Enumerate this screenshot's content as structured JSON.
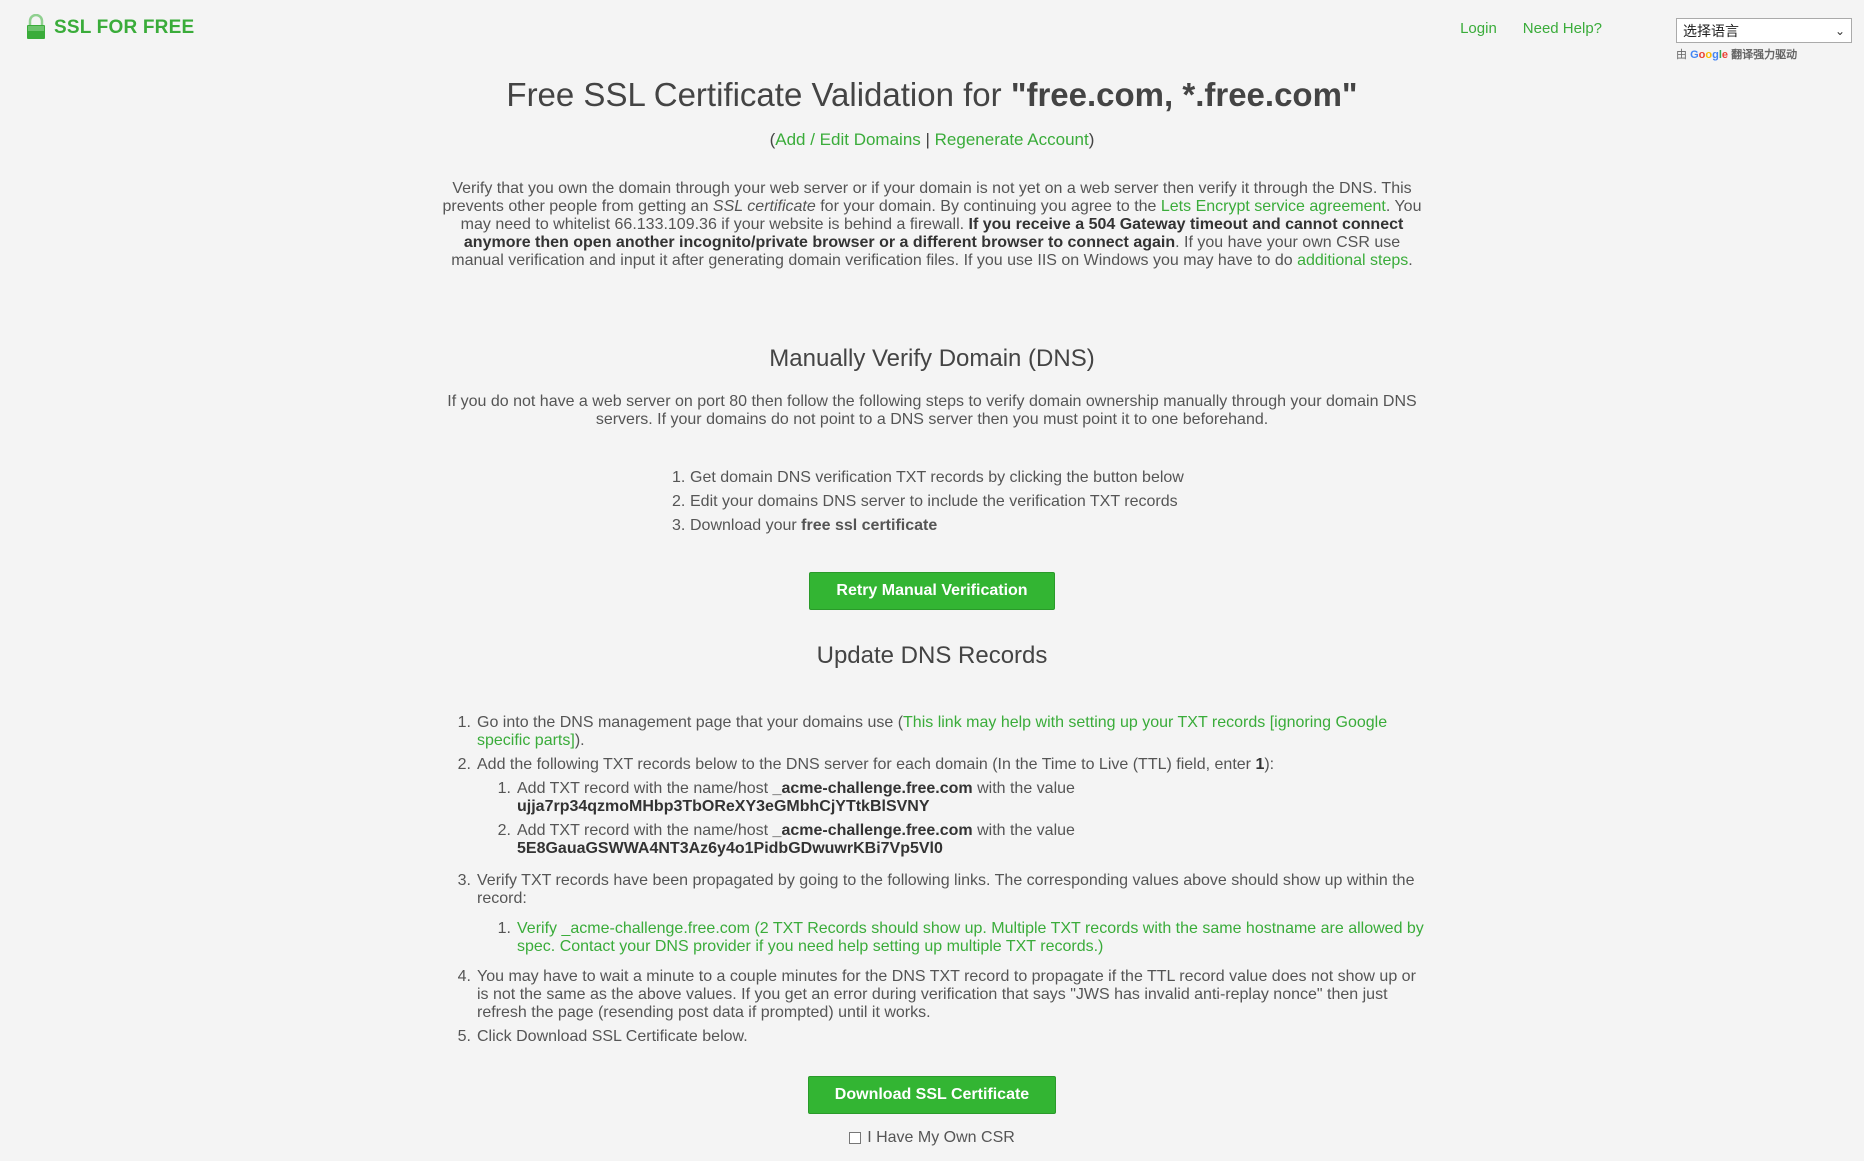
{
  "header": {
    "logo_text": "SSL FOR FREE",
    "nav": {
      "login": "Login",
      "help": "Need Help?"
    },
    "language": {
      "selected": "选择语言",
      "powered_prefix": "由",
      "google": "Google",
      "powered_suffix": "翻译强力驱动"
    }
  },
  "title": {
    "prefix": "Free SSL Certificate Validation for ",
    "domains": "\"free.com, *.free.com\""
  },
  "sublinks": {
    "open": "(",
    "add_edit": "Add / Edit Domains",
    "sep": " | ",
    "regenerate": "Regenerate Account",
    "close": ")"
  },
  "intro": {
    "t1": "Verify that you own the domain through your web server or if your domain is not yet on a web server then verify it through the DNS. This prevents other people from getting an ",
    "em": "SSL certificate",
    "t2": " for your domain. By continuing you agree to the ",
    "link1": "Lets Encrypt service agreement",
    "t3": ". You may need to whitelist 66.133.109.36 if your website is behind a firewall. ",
    "bold": "If you receive a 504 Gateway timeout and cannot connect anymore then open another incognito/private browser or a different browser to connect again",
    "t4": ". If you have your own CSR use manual verification and input it after generating domain verification files. If you use IIS on Windows you may have to do ",
    "link2": "additional steps",
    "t5": "."
  },
  "manual": {
    "heading": "Manually Verify Domain (DNS)",
    "desc": "If you do not have a web server on port 80 then follow the following steps to verify domain ownership manually through your domain DNS servers. If your domains do not point to a DNS server then you must point it to one beforehand.",
    "steps": [
      {
        "num": "1.",
        "text": "Get domain DNS verification TXT records by clicking the button below"
      },
      {
        "num": "2.",
        "text": "Edit your domains DNS server to include the verification TXT records"
      },
      {
        "num": "3.",
        "text": "Download your ",
        "bold": "free ssl certificate"
      }
    ],
    "retry_button": "Retry Manual Verification"
  },
  "update": {
    "heading": "Update DNS Records",
    "item1": {
      "num": "1.",
      "pre": "Go into the DNS management page that your domains use (",
      "link": "This link may help with setting up your TXT records [ignoring Google specific parts]",
      "post": ")."
    },
    "item2": {
      "num": "2.",
      "pre": "Add the following TXT records below to the DNS server for each domain (In the Time to Live (TTL) field, enter ",
      "ttl": "1",
      "post": "):"
    },
    "records": [
      {
        "num": "1.",
        "pre": "Add TXT record with the name/host ",
        "host": "_acme-challenge.free.com",
        "mid": " with the value",
        "value": "ujja7rp34qzmoMHbp3TbOReXY3eGMbhCjYTtkBlSVNY"
      },
      {
        "num": "2.",
        "pre": "Add TXT record with the name/host ",
        "host": "_acme-challenge.free.com",
        "mid": " with the value",
        "value": "5E8GauaGSWWA4NT3Az6y4o1PidbGDwuwrKBi7Vp5Vl0"
      }
    ],
    "item3": {
      "num": "3.",
      "text": "Verify TXT records have been propagated by going to the following links. The corresponding values above should show up within the record:"
    },
    "verify_link": {
      "num": "1.",
      "text": "Verify _acme-challenge.free.com (2 TXT Records should show up. Multiple TXT records with the same hostname are allowed by spec. Contact your DNS provider if you need help setting up multiple TXT records.)"
    },
    "item4": {
      "num": "4.",
      "text": "You may have to wait a minute to a couple minutes for the DNS TXT record to propagate if the TTL record value does not show up or is not the same as the above values. If you get an error during verification that says \"JWS has invalid anti-replay nonce\" then just refresh the page (resending post data if prompted) until it works."
    },
    "item5": {
      "num": "5.",
      "text": "Click Download SSL Certificate below."
    },
    "download_button": "Download SSL Certificate",
    "csr_label": "I Have My Own CSR"
  },
  "colors": {
    "accent": "#3aac3a",
    "button": "#33b533",
    "background": "#f4f4f4"
  }
}
